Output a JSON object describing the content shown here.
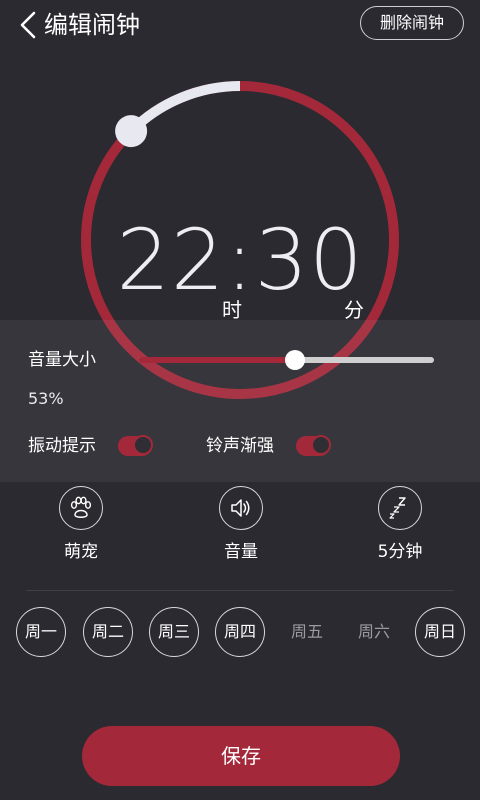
{
  "header": {
    "title": "编辑闹钟",
    "delete_label": "删除闹钟"
  },
  "clock": {
    "time": "22:30",
    "hour_unit": "时",
    "minute_unit": "分",
    "arc_progress": 0.875
  },
  "volume": {
    "label": "音量大小",
    "percent_text": "53%",
    "value": 0.53
  },
  "options": [
    {
      "label": "振动提示",
      "on": true
    },
    {
      "label": "铃声渐强",
      "on": true
    }
  ],
  "features": [
    {
      "label": "萌宠",
      "icon": "paw-icon"
    },
    {
      "label": "音量",
      "icon": "speaker-icon"
    },
    {
      "label": "5分钟",
      "icon": "snooze-icon"
    }
  ],
  "days": [
    {
      "label": "周一",
      "selected": true
    },
    {
      "label": "周二",
      "selected": true
    },
    {
      "label": "周三",
      "selected": true
    },
    {
      "label": "周四",
      "selected": true
    },
    {
      "label": "周五",
      "selected": false
    },
    {
      "label": "周六",
      "selected": false
    },
    {
      "label": "周日",
      "selected": true
    }
  ],
  "save_label": "保存",
  "colors": {
    "accent": "#a3293a",
    "background": "#2a2a30",
    "light": "#eeeef2"
  }
}
